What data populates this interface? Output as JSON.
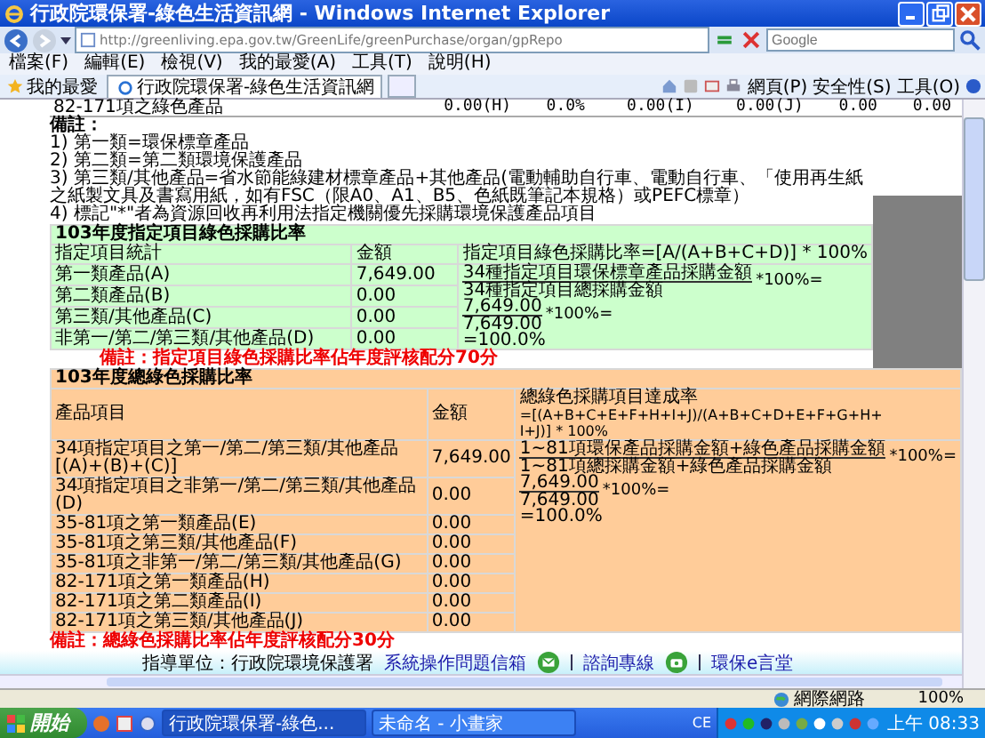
{
  "window": {
    "title": "行政院環保署-綠色生活資訊網 - Windows Internet Explorer"
  },
  "address_bar": {
    "url": "http://greenliving.epa.gov.tw/GreenLife/greenPurchase/organ/gpRepo"
  },
  "search": {
    "placeholder": "Google"
  },
  "menu": [
    "檔案(F)",
    "編輯(E)",
    "檢視(V)",
    "我的最愛(A)",
    "工具(T)",
    "說明(H)"
  ],
  "favorites_bar": {
    "favorites": "我的最愛",
    "tab": "行政院環保署-綠色生活資訊網",
    "commands": [
      "網頁(P)",
      "安全性(S)",
      "工具(O)"
    ]
  },
  "page": {
    "top_row": [
      "82-171項之綠色產品",
      "0.00(H)",
      "0.0%",
      "0.00(I)",
      "0.00(J)",
      "0.00",
      "0.00"
    ],
    "notes": {
      "title": "備註：",
      "items": [
        "1) 第一類=環保標章產品",
        "2) 第二類=第二類環境保護產品",
        "3) 第三類/其他產品=省水節能綠建材標章產品+其他產品(電動輔助自行車、電動自行車、「使用再生紙之紙製文具及書寫用紙，如有FSC（限A0、A1、B5、色紙既筆記本規格）或PEFC標章）",
        "4) 標記\"*\"者為資源回收再利用法指定機關優先採購環境保護產品項目"
      ]
    },
    "designated_table": {
      "title": "103年度指定項目綠色採購比率",
      "columns": [
        "指定項目統計",
        "金額",
        "指定項目綠色採購比率=[A/(A+B+C+D)] * 100%"
      ],
      "rows": [
        {
          "item": "第一類產品(A)",
          "amount": "7,649.00"
        },
        {
          "item": "第二類產品(B)",
          "amount": "0.00"
        },
        {
          "item": "第三類/其他產品(C)",
          "amount": "0.00"
        },
        {
          "item": "非第一/第二/第三類/其他產品(D)",
          "amount": "0.00"
        }
      ],
      "fractions": [
        {
          "numerator": "34種指定項目環保標章產品採購金額",
          "denominator": "34種指定項目總採購金額",
          "suffix": "*100%="
        },
        {
          "numerator": "7,649.00",
          "denominator": "7,649.00",
          "suffix": "*100%="
        }
      ],
      "result": "=100.0%"
    },
    "designated_note": "備註：指定項目綠色採購比率佔年度評核配分70分",
    "total_table": {
      "title": "103年度總綠色採購比率",
      "columns": [
        "產品項目",
        "金額",
        "總綠色採購項目達成率"
      ],
      "formula": "=[(A+B+C+E+F+H+I+J)/(A+B+C+D+E+F+G+H+I+J)] * 100%",
      "rows": [
        {
          "item": "34項指定項目之第一/第二/第三類/其他產品[(A)+(B)+(C)]",
          "amount": "7,649.00"
        },
        {
          "item": "34項指定項目之非第一/第二/第三類/其他產品(D)",
          "amount": "0.00"
        },
        {
          "item": "35-81項之第一類產品(E)",
          "amount": "0.00"
        },
        {
          "item": "35-81項之第三類/其他產品(F)",
          "amount": "0.00"
        },
        {
          "item": "35-81項之非第一/第二/第三類/其他產品(G)",
          "amount": "0.00"
        },
        {
          "item": "82-171項之第一類產品(H)",
          "amount": "0.00"
        },
        {
          "item": "82-171項之第二類產品(I)",
          "amount": "0.00"
        },
        {
          "item": "82-171項之第三類/其他產品(J)",
          "amount": "0.00"
        }
      ],
      "fractions": [
        {
          "numerator": "1~81項環保產品採購金額+綠色產品採購金額",
          "denominator": "1~81項總採購金額+綠色產品採購金額",
          "suffix": "*100%="
        },
        {
          "numerator": "7,649.00",
          "denominator": "7,649.00",
          "suffix": "*100%="
        }
      ],
      "result": "=100.0%"
    },
    "total_note": "備註：總綠色採購比率佔年度評核配分30分"
  },
  "footer": {
    "organization": "指導單位：行政院環境保護署",
    "links": [
      {
        "label": "系統操作問題信箱",
        "kind": "mail"
      },
      {
        "label": "諮詢專線",
        "kind": "phone"
      },
      {
        "label": "環保e言堂",
        "kind": "none"
      }
    ]
  },
  "status_bar": {
    "zone": "網際網路",
    "zoom": "100%"
  },
  "taskbar": {
    "start": "開始",
    "tasks": [
      {
        "label": "行政院環保署-綠色...",
        "selected": true
      },
      {
        "label": "未命名 - 小畫家",
        "selected": false
      }
    ],
    "language": "CE",
    "clock": "上午 08:33"
  }
}
